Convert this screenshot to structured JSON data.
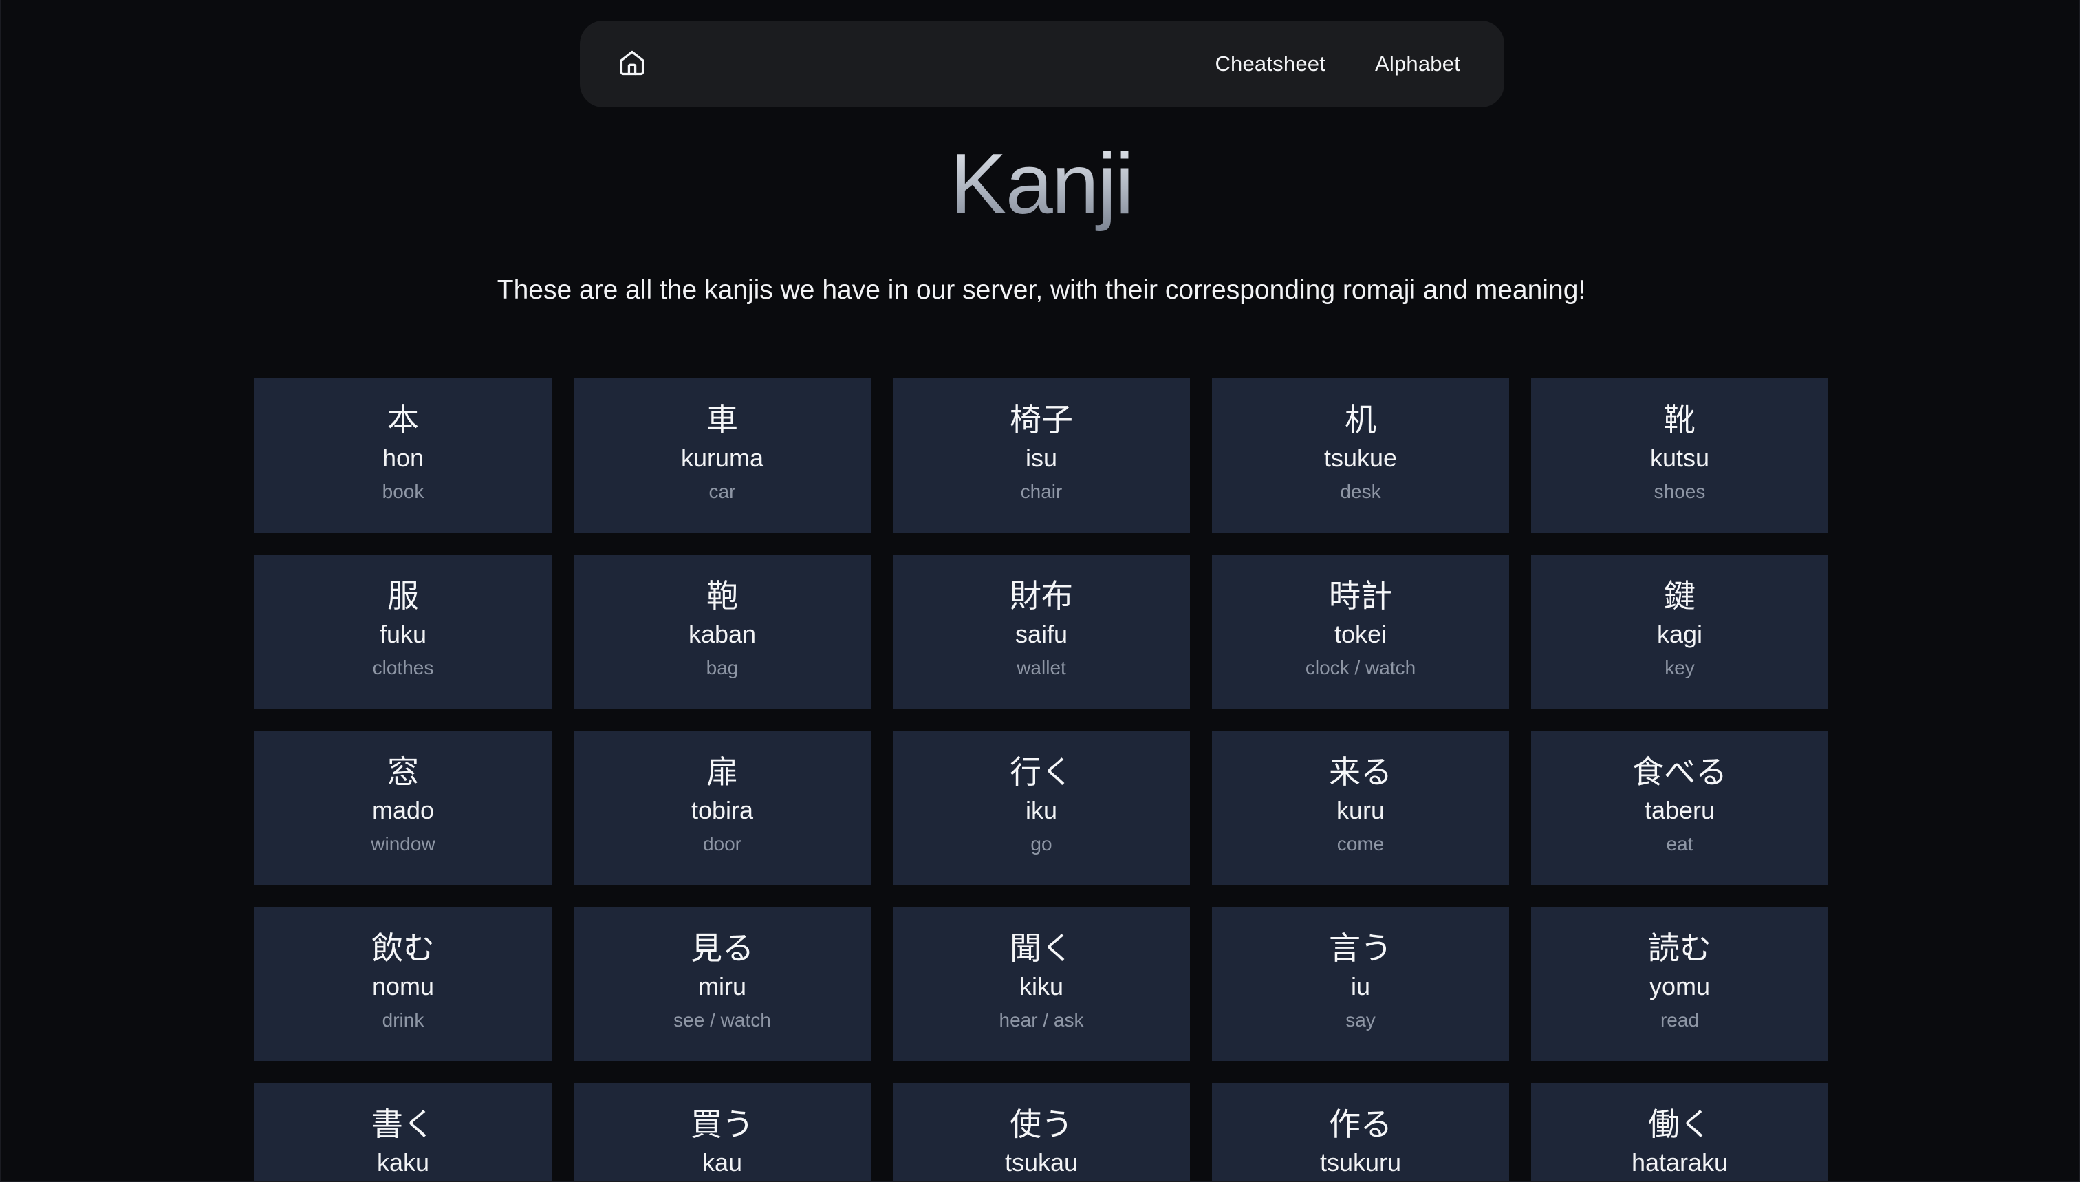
{
  "nav": {
    "home_icon": "home-icon",
    "links": [
      "Cheatsheet",
      "Alphabet"
    ]
  },
  "header": {
    "title": "Kanji",
    "subtitle": "These are all the kanjis we have in our server, with their corresponding romaji and meaning!"
  },
  "cards": [
    {
      "kanji": "本",
      "romaji": "hon",
      "meaning": "book"
    },
    {
      "kanji": "車",
      "romaji": "kuruma",
      "meaning": "car"
    },
    {
      "kanji": "椅子",
      "romaji": "isu",
      "meaning": "chair"
    },
    {
      "kanji": "机",
      "romaji": "tsukue",
      "meaning": "desk"
    },
    {
      "kanji": "靴",
      "romaji": "kutsu",
      "meaning": "shoes"
    },
    {
      "kanji": "服",
      "romaji": "fuku",
      "meaning": "clothes"
    },
    {
      "kanji": "鞄",
      "romaji": "kaban",
      "meaning": "bag"
    },
    {
      "kanji": "財布",
      "romaji": "saifu",
      "meaning": "wallet"
    },
    {
      "kanji": "時計",
      "romaji": "tokei",
      "meaning": "clock / watch"
    },
    {
      "kanji": "鍵",
      "romaji": "kagi",
      "meaning": "key"
    },
    {
      "kanji": "窓",
      "romaji": "mado",
      "meaning": "window"
    },
    {
      "kanji": "扉",
      "romaji": "tobira",
      "meaning": "door"
    },
    {
      "kanji": "行く",
      "romaji": "iku",
      "meaning": "go"
    },
    {
      "kanji": "来る",
      "romaji": "kuru",
      "meaning": "come"
    },
    {
      "kanji": "食べる",
      "romaji": "taberu",
      "meaning": "eat"
    },
    {
      "kanji": "飲む",
      "romaji": "nomu",
      "meaning": "drink"
    },
    {
      "kanji": "見る",
      "romaji": "miru",
      "meaning": "see / watch"
    },
    {
      "kanji": "聞く",
      "romaji": "kiku",
      "meaning": "hear / ask"
    },
    {
      "kanji": "言う",
      "romaji": "iu",
      "meaning": "say"
    },
    {
      "kanji": "読む",
      "romaji": "yomu",
      "meaning": "read"
    },
    {
      "kanji": "書く",
      "romaji": "kaku",
      "meaning": ""
    },
    {
      "kanji": "買う",
      "romaji": "kau",
      "meaning": ""
    },
    {
      "kanji": "使う",
      "romaji": "tsukau",
      "meaning": ""
    },
    {
      "kanji": "作る",
      "romaji": "tsukuru",
      "meaning": ""
    },
    {
      "kanji": "働く",
      "romaji": "hataraku",
      "meaning": ""
    }
  ]
}
